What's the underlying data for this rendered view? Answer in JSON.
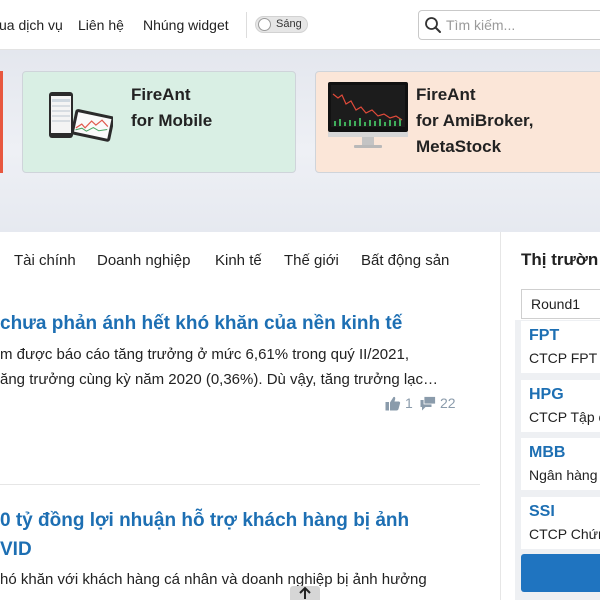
{
  "nav": {
    "links": [
      "ua dịch vụ",
      "Liên hệ",
      "Nhúng widget"
    ],
    "theme_label": "Sáng",
    "search_placeholder": "Tìm kiếm..."
  },
  "promos": [
    {
      "title_line1": "FireAnt",
      "title_line2": "for Mobile"
    },
    {
      "title_line1": "FireAnt",
      "title_line2": "for AmiBroker,",
      "title_line3": "MetaStock"
    }
  ],
  "categories": [
    "Tài chính",
    "Doanh nghiệp",
    "Kinh tế",
    "Thế giới",
    "Bất động sản"
  ],
  "articles": [
    {
      "title": "chưa phản ánh hết khó khăn của nền kinh tế",
      "summary_line1": "m được báo cáo tăng trưởng ở mức 6,61% trong quý II/2021,",
      "summary_line2": "ăng trưởng cùng kỳ năm 2020 (0,36%). Dù vậy, tăng trưởng lạc…",
      "likes": "1",
      "comments": "22"
    },
    {
      "title_line1": "0 tỷ đồng lợi nhuận hỗ trợ khách hàng bị ảnh",
      "title_line2": "VID",
      "summary_line1": "hó khăn với khách hàng cá nhân và doanh nghiệp bị ảnh hưởng"
    }
  ],
  "market": {
    "title": "Thị trườn",
    "round_select": "Round1",
    "stocks": [
      {
        "symbol": "FPT",
        "name": "CTCP FPT"
      },
      {
        "symbol": "HPG",
        "name": "CTCP Tập c"
      },
      {
        "symbol": "MBB",
        "name": "Ngân hàng"
      },
      {
        "symbol": "SSI",
        "name": "CTCP Chứn"
      }
    ]
  },
  "icons": {
    "search": "search-icon",
    "like": "thumbs-up-icon",
    "comment": "comment-icon",
    "scroll_top": "arrow-up-icon"
  },
  "colors": {
    "link_blue": "#1d6fb3",
    "button_blue": "#1f74c0",
    "mobile_card": "#d9efe4",
    "ami_card": "#fbe6d8",
    "red_accent": "#e8573f"
  }
}
